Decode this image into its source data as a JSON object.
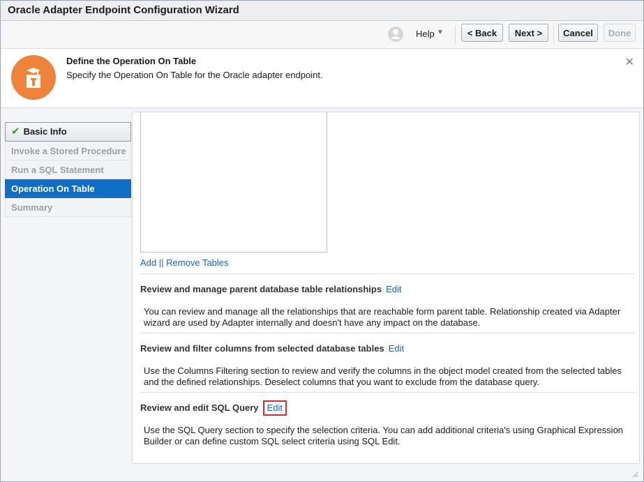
{
  "window": {
    "title": "Oracle Adapter Endpoint Configuration Wizard"
  },
  "toolbar": {
    "help_label": "Help",
    "back_label": "< Back",
    "next_label": "Next >",
    "cancel_label": "Cancel",
    "done_label": "Done"
  },
  "header": {
    "title": "Define the Operation On Table",
    "subtitle": "Specify the Operation On Table for the Oracle adapter endpoint."
  },
  "nav": {
    "items": [
      {
        "label": "Basic Info",
        "state": "completed"
      },
      {
        "label": "Invoke a Stored Procedure",
        "state": "disabled"
      },
      {
        "label": "Run a SQL Statement",
        "state": "disabled"
      },
      {
        "label": "Operation On Table",
        "state": "active"
      },
      {
        "label": "Summary",
        "state": "disabled"
      }
    ]
  },
  "main": {
    "tables_links": {
      "add": "Add",
      "separator": "||",
      "remove": "Remove Tables"
    },
    "sections": [
      {
        "title": "Review and manage parent database table relationships",
        "edit": "Edit",
        "body": "You can review and manage all the relationships that are reachable form parent table. Relationship created via Adapter wizard are used by Adapter internally and doesn't have any impact on the database."
      },
      {
        "title": "Review and filter columns from selected database tables",
        "edit": "Edit",
        "body": "Use the Columns Filtering section to review and verify the columns in the object model created from the selected tables and the defined relationships. Deselect columns that you want to exclude from the database query."
      },
      {
        "title": "Review and edit SQL Query",
        "edit": "Edit",
        "body": "Use the SQL Query section to specify the selection criteria. You can add additional criteria's using Graphical Expression Builder or can define custom SQL select criteria using SQL Edit."
      }
    ]
  },
  "colors": {
    "accent": "#0f6fc6",
    "header_icon": "#ef8339",
    "highlight": "#e1262d",
    "link": "#1565c0"
  },
  "icons": [
    "user-icon",
    "chevron-down-icon",
    "close-icon",
    "checkmark-icon",
    "wizard-icon",
    "resize-grip-icon"
  ]
}
